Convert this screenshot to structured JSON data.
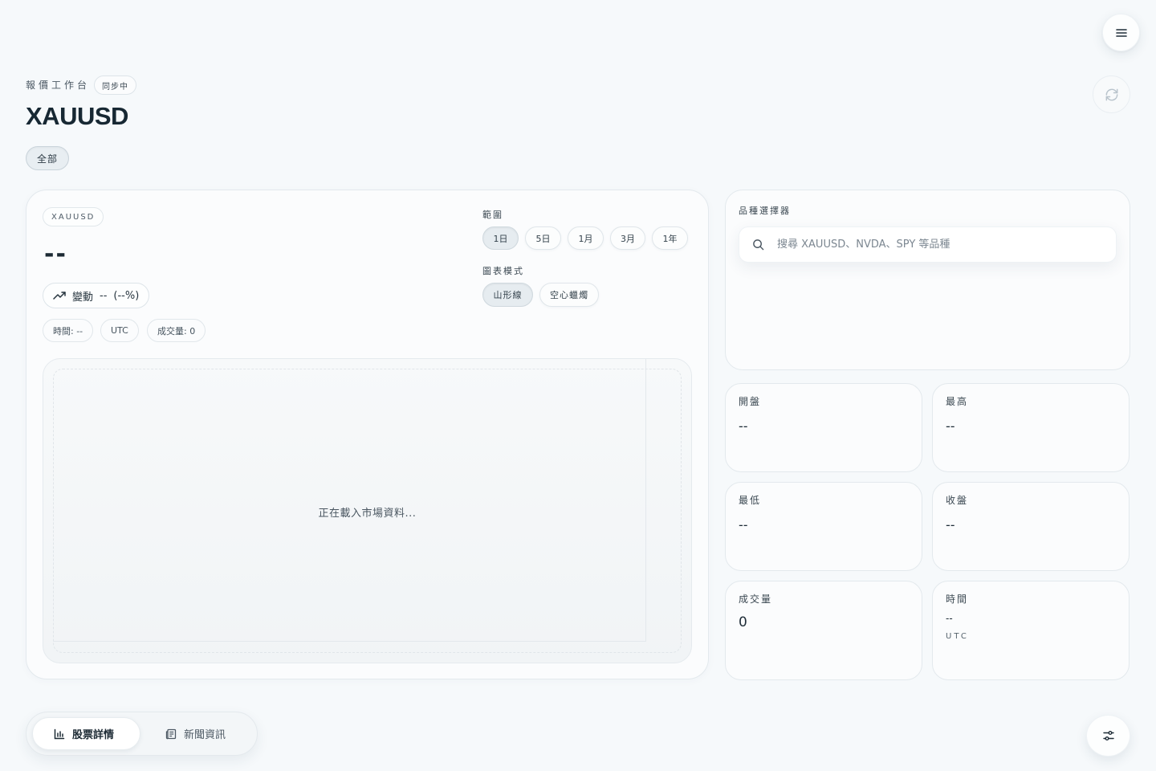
{
  "header": {
    "eyebrow": "報價工作台",
    "sync_status": "同步中",
    "title": "XAUUSD",
    "filter_chip": "全部"
  },
  "quote": {
    "symbol": "XAUUSD",
    "price": "--",
    "change_label": "變動",
    "change_value": "--",
    "change_pct": "(--%)",
    "time": "時間: --",
    "timezone": "UTC",
    "volume": "成交量: 0"
  },
  "controls": {
    "range_label": "範圍",
    "ranges": [
      "1日",
      "5日",
      "1月",
      "3月",
      "1年"
    ],
    "active_range": "1日",
    "mode_label": "圖表模式",
    "modes": [
      "山形線",
      "空心蠟燭"
    ],
    "active_mode": "山形線"
  },
  "chart": {
    "loading_text": "正在載入市場資料..."
  },
  "picker": {
    "label": "品種選擇器",
    "search_placeholder": "搜尋 XAUUSD、NVDA、SPY 等品種"
  },
  "stats": {
    "open_label": "開盤",
    "open_value": "--",
    "high_label": "最高",
    "high_value": "--",
    "low_label": "最低",
    "low_value": "--",
    "close_label": "收盤",
    "close_value": "--",
    "volume_label": "成交量",
    "volume_value": "0",
    "time_label": "時間",
    "time_value": "--",
    "time_zone": "UTC"
  },
  "bottom_nav": {
    "tab_details": "股票詳情",
    "tab_news": "新聞資訊"
  },
  "icons": {
    "menu": "menu-icon",
    "refresh": "refresh-icon",
    "trend": "trending-up-icon",
    "search": "search-icon",
    "bar_chart": "bar-chart-icon",
    "news": "newspaper-icon",
    "settings": "sliders-icon"
  }
}
